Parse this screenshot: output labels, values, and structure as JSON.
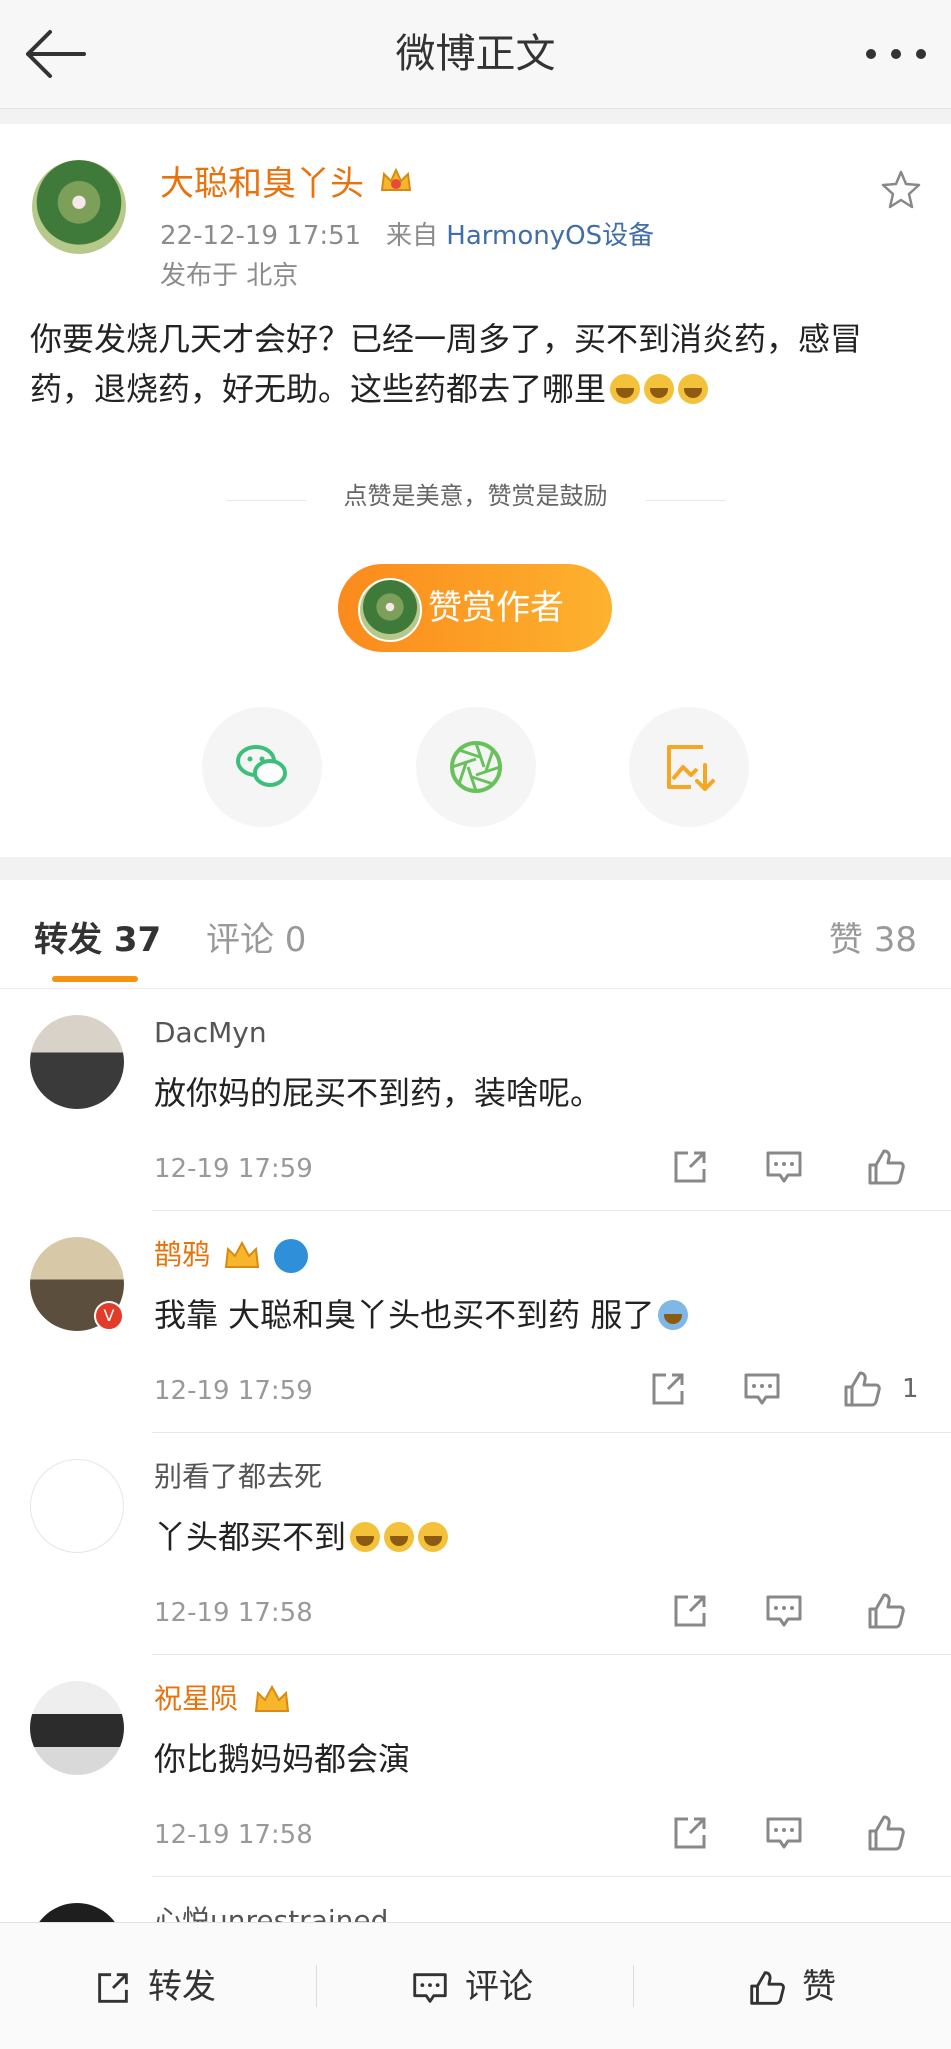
{
  "header": {
    "title": "微博正文"
  },
  "post": {
    "author": "大聪和臭丫头",
    "time": "22-12-19 17:51",
    "source_prefix": "来自",
    "source": "HarmonyOS设备",
    "location": "发布于 北京",
    "text": "你要发烧几天才会好？已经一周多了，买不到消炎药，感冒药，退烧药，好无助。这些药都去了哪里",
    "reward_tip": "点赞是美意，赞赏是鼓励",
    "reward_button": "赞赏作者"
  },
  "tabs": {
    "repost": "转发 37",
    "comment": "评论 0",
    "like": "赞 38"
  },
  "reposts": [
    {
      "name": "DacMyn",
      "text": "放你妈的屁买不到药，装啥呢。",
      "time": "12-19 17:59",
      "likes": ""
    },
    {
      "name": "鹊鸦",
      "text": "我靠 大聪和臭丫头也买不到药 服了",
      "time": "12-19 17:59",
      "likes": "1"
    },
    {
      "name": "别看了都去死",
      "text": "丫头都买不到",
      "time": "12-19 17:58",
      "likes": ""
    },
    {
      "name": "祝星陨",
      "text": "你比鹅妈妈都会演",
      "time": "12-19 17:58",
      "likes": ""
    },
    {
      "name": "心悦unrestrained",
      "text": "",
      "time": "",
      "likes": ""
    }
  ],
  "bottom_bar": {
    "repost": "转发",
    "comment": "评论",
    "like": "赞"
  },
  "colors": {
    "accent": "#f79313",
    "vip_name": "#e8720c",
    "link": "#3f6ea8"
  }
}
